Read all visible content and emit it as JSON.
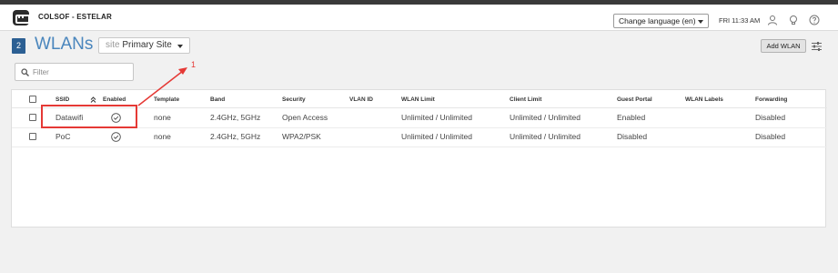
{
  "header": {
    "org_name": "COLSOF - ESTELAR",
    "language_select": "Change language (en)",
    "clock": "FRI 11:33 AM",
    "icons": [
      "app-logo-icon",
      "user-icon",
      "bulb-icon",
      "help-icon"
    ]
  },
  "page": {
    "count": "2",
    "title": "WLANs",
    "site_keyword": "site",
    "site_name": "Primary Site",
    "add_button": "Add WLAN"
  },
  "filter": {
    "placeholder": "Filter",
    "value": ""
  },
  "table": {
    "columns": [
      "SSID",
      "Enabled",
      "Template",
      "Band",
      "Security",
      "VLAN ID",
      "WLAN Limit",
      "Client Limit",
      "Guest Portal",
      "WLAN Labels",
      "Forwarding"
    ],
    "rows": [
      {
        "ssid": "Datawifi",
        "enabled": true,
        "template": "none",
        "band": "2.4GHz, 5GHz",
        "security": "Open Access",
        "vlan_id": "",
        "wlan_limit": "Unlimited / Unlimited",
        "client_limit": "Unlimited / Unlimited",
        "guest_portal": "Enabled",
        "wlan_labels": "",
        "forwarding": "Disabled"
      },
      {
        "ssid": "PoC",
        "enabled": true,
        "template": "none",
        "band": "2.4GHz, 5GHz",
        "security": "WPA2/PSK",
        "vlan_id": "",
        "wlan_limit": "Unlimited / Unlimited",
        "client_limit": "Unlimited / Unlimited",
        "guest_portal": "Disabled",
        "wlan_labels": "",
        "forwarding": "Disabled"
      }
    ]
  },
  "annotation": {
    "label": "1",
    "color": "#e53935"
  },
  "colors": {
    "accent": "#4a86bd",
    "badge": "#2c5f93",
    "annotation": "#e53935"
  }
}
